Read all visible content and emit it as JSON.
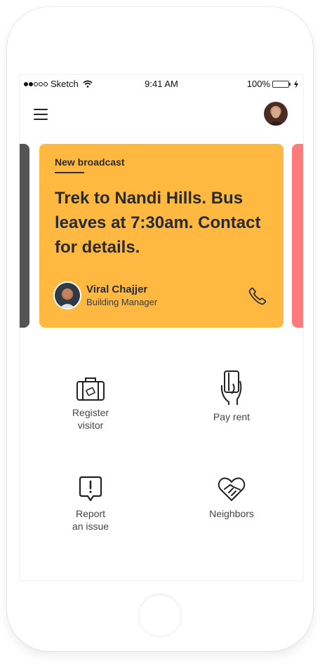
{
  "status_bar": {
    "carrier": "Sketch",
    "time": "9:41 AM",
    "battery": "100%",
    "signal_bars_filled": 2,
    "signal_bars_total": 5
  },
  "header": {
    "menu_icon": "hamburger-icon",
    "avatar_icon": "user-avatar"
  },
  "broadcast": {
    "label": "New broadcast",
    "message": "Trek to Nandi Hills. Bus leaves at 7:30am. Contact for details.",
    "author_name": "Viral Chajjer",
    "author_role": "Building Manager",
    "call_icon": "phone-icon",
    "color": "#ffb840"
  },
  "side_cards": {
    "left_color": "#555555",
    "right_color": "#ff7b7b"
  },
  "actions": [
    {
      "label": "Register\nvisitor",
      "icon": "suitcase-icon"
    },
    {
      "label": "Pay rent",
      "icon": "card-payment-icon"
    },
    {
      "label": "Report\nan issue",
      "icon": "alert-bubble-icon"
    },
    {
      "label": "Neighbors",
      "icon": "handshake-icon"
    }
  ]
}
